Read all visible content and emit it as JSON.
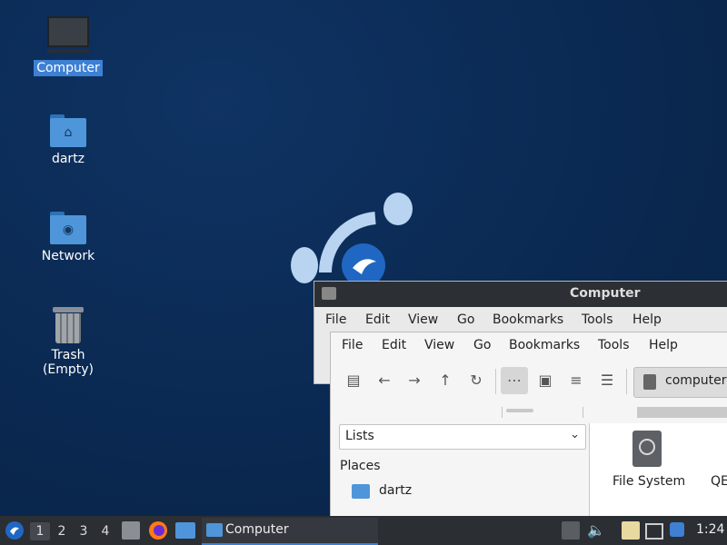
{
  "desktop": {
    "icons": [
      {
        "label": "Computer"
      },
      {
        "label": "dartz"
      },
      {
        "label": "Network"
      },
      {
        "label": "Trash (Empty)"
      }
    ]
  },
  "back_window": {
    "title": "Computer",
    "menu": [
      "File",
      "Edit",
      "View",
      "Go",
      "Bookmarks",
      "Tools",
      "Help"
    ]
  },
  "front_window": {
    "menu": [
      "File",
      "Edit",
      "View",
      "Go",
      "Bookmarks",
      "Tools",
      "Help"
    ],
    "address": "computer:",
    "side_combo": "Lists",
    "places_header": "Places",
    "places": [
      {
        "label": "dartz"
      }
    ],
    "items": [
      {
        "label": "File System"
      },
      {
        "label": "QE"
      }
    ]
  },
  "taskbar": {
    "workspaces": [
      "1",
      "2",
      "3",
      "4"
    ],
    "active_workspace": "1",
    "task_label": "Computer",
    "clock": "1:24"
  },
  "colors": {
    "desktop_bg": "#0a2850",
    "selection": "#3d80d4",
    "folder": "#4f95d9",
    "taskbar": "#2b2e33"
  }
}
